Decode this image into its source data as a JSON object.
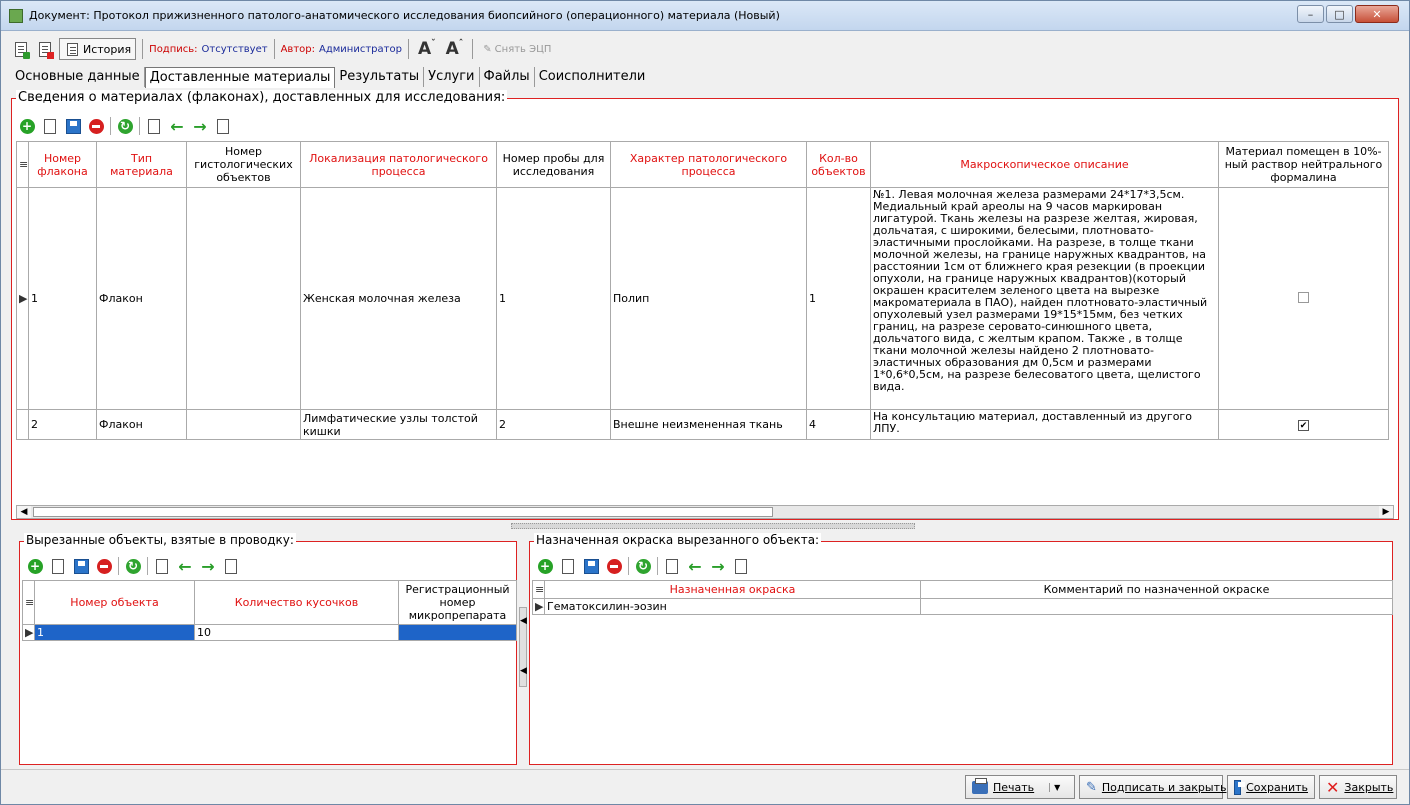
{
  "window": {
    "title": "Документ: Протокол прижизненного патолого-анатомического исследования биопсийного (операционного) материала (Новый)",
    "controls": [
      "–",
      "□",
      "✕"
    ]
  },
  "toolbar": {
    "history_label": "История",
    "signature_prefix": "Подпись:",
    "signature_value": "Отсутствует",
    "author_prefix": "Автор:",
    "author_value": "Администратор",
    "font_decrease": "A",
    "font_increase": "A",
    "remove_sign_label": "Снять ЭЦП"
  },
  "tabs": [
    "Основные данные",
    "Доставленные материалы",
    "Результаты",
    "Услуги",
    "Файлы",
    "Соисполнители"
  ],
  "materials": {
    "title": "Сведения о материалах (флаконах), доставленных для исследования:",
    "columns": [
      "Номер флакона",
      "Тип материала",
      "Номер гистологических объектов",
      "Локализация патологического процесса",
      "Номер пробы для исследования",
      "Характер патологического процесса",
      "Кол-во объектов",
      "Макроскопическое описание",
      "Материал помещен в 10%-ный раствор нейтрального формалина"
    ],
    "rows": [
      {
        "num": "1",
        "type": "Флакон",
        "histo": "",
        "localization": "Женская молочная железа",
        "sample": "1",
        "character": "Полип",
        "count": "1",
        "macro": "№1. Левая молочная железа размерами 24*17*3,5см. Медиальный край ареолы на 9 часов маркирован лигатурой. Ткань железы на разрезе желтая, жировая, дольчатая, с широкими, белесыми, плотновато-эластичными прослойками. На разрезе, в толще ткани молочной железы, на границе наружных  квадрантов, на расстоянии 1см от ближнего края резекции (в проекции опухоли, на границе наружных  квадрантов)(который окрашен красителем зеленого цвета на вырезке макроматериала в ПАО), найден плотновато-эластичный опухолевый узел размерами 19*15*15мм, без четких границ, на разрезе серовато-синюшного цвета, дольчатого вида, с желтым крапом. Также , в толще ткани молочной железы найдено 2 плотновато-эластичных образования дм 0,5см и размерами 1*0,6*0,5см, на разрезе белесоватого цвета, щелистого вида.",
        "formalin": false
      },
      {
        "num": "2",
        "type": "Флакон",
        "histo": "",
        "localization": "Лимфатические узлы толстой кишки",
        "sample": "2",
        "character": "Внешне неизмененная ткань",
        "count": "4",
        "macro": "На консультацию материал, доставленный из другого ЛПУ.",
        "formalin": true
      }
    ]
  },
  "cut_objects": {
    "title": "Вырезанные объекты, взятые в проводку:",
    "columns": [
      "Номер объекта",
      "Количество кусочков",
      "Регистрационный номер микропрепарата"
    ],
    "rows": [
      {
        "num": "1",
        "pieces": "10",
        "reg": ""
      }
    ]
  },
  "staining": {
    "title": "Назначенная окраска вырезанного объекта:",
    "columns": [
      "Назначенная окраска",
      "Комментарий по назначенной окраске"
    ],
    "rows": [
      {
        "stain": "Гематоксилин-эозин",
        "comment": ""
      }
    ]
  },
  "footer": {
    "print": "Печать",
    "sign_close": "Подписать и закрыть",
    "save": "Сохранить",
    "close": "Закрыть"
  },
  "colors": {
    "accent_red": "#d22222",
    "header_red": "#e01010",
    "selection_blue": "#1e64c8"
  }
}
